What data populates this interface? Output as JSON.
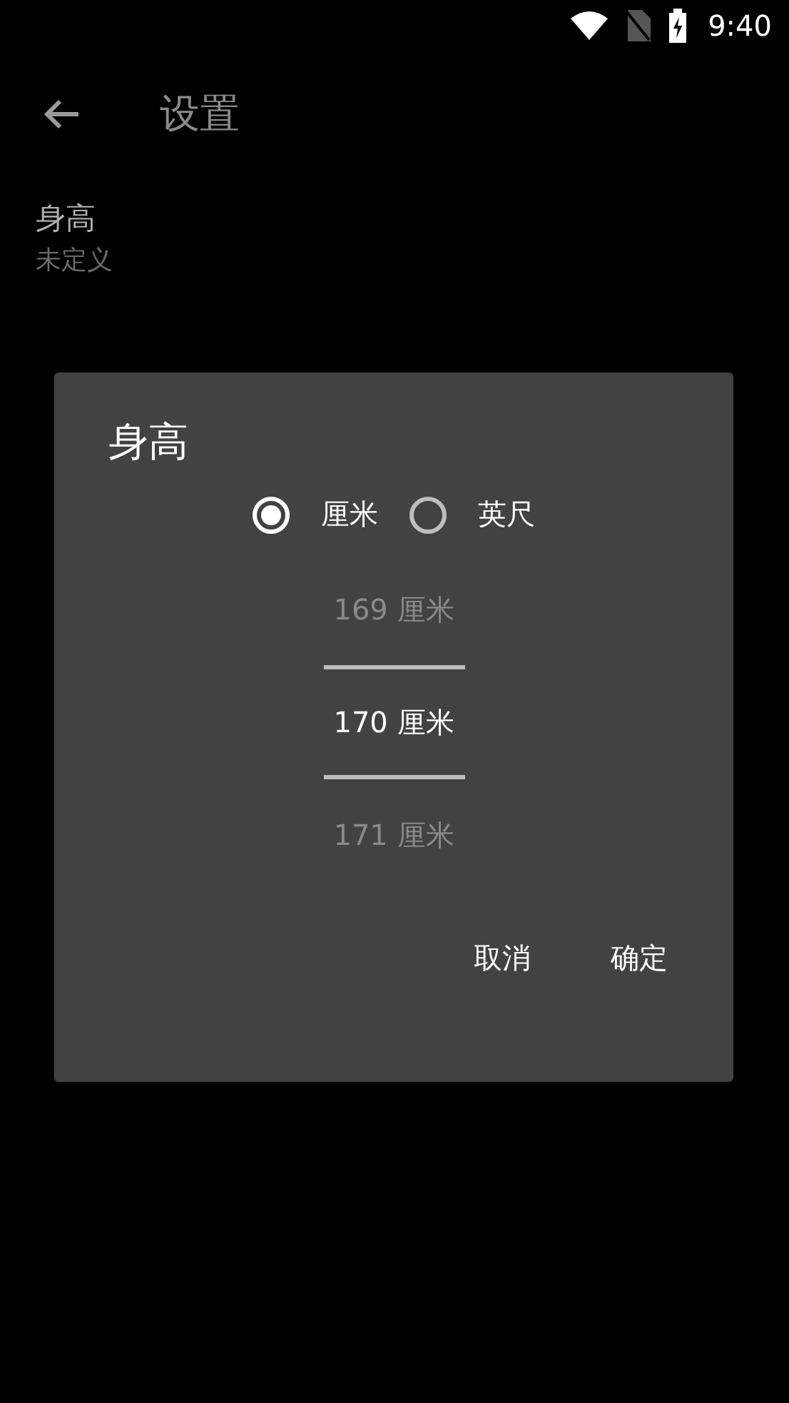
{
  "status_bar": {
    "time": "9:40"
  },
  "toolbar": {
    "title": "设置"
  },
  "settings": [
    {
      "title": "身高",
      "summary": "未定义"
    }
  ],
  "dialog": {
    "title": "身高",
    "units": [
      {
        "label": "厘米",
        "selected": true
      },
      {
        "label": "英尺",
        "selected": false
      }
    ],
    "picker": [
      {
        "label": "169 厘米",
        "selected": false
      },
      {
        "label": "170 厘米",
        "selected": true
      },
      {
        "label": "171 厘米",
        "selected": false
      }
    ],
    "buttons": [
      "取消",
      "确定"
    ]
  }
}
